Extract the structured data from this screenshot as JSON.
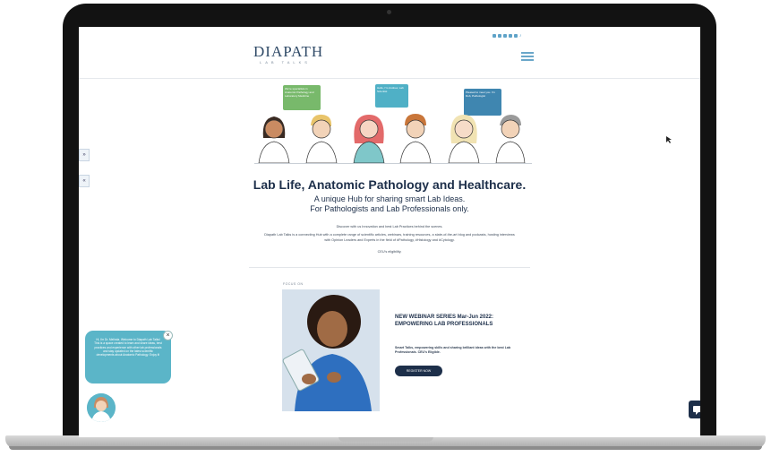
{
  "site": {
    "logo": "DIAPATH",
    "logo_sub": "LAB TALKS"
  },
  "header": {
    "social_icons": [
      "facebook-icon",
      "twitter-icon",
      "linkedin-icon",
      "instagram-icon",
      "youtube-icon",
      "spotify-icon"
    ]
  },
  "side_tabs": [
    "»",
    "«"
  ],
  "illustration": {
    "bubbles": [
      "We're specialists in Anatomic Pathology and Laboratory Medicine",
      "Hello, I'm Andrew, Lab Scientist",
      "Pleased to meet you. I'm Rob, Pathologist"
    ],
    "colors": [
      "#78b96b",
      "#4fb0c6",
      "#3f86b0"
    ]
  },
  "hero": {
    "title": "Lab Life, Anatomic Pathology and Healthcare.",
    "subtitle_1": "A unique Hub for sharing smart Lab Ideas.",
    "subtitle_2": "For Pathologists and Lab Professionals only.",
    "line_1": "Discover with us Innovation and best Lab Practices behind the scenes.",
    "line_2": "Diapath Lab Talks is a connecting Hub with a complete range of scientific articles, webinars, training resources, a state-of-the-art blog and podcasts, hosting interviews",
    "line_3": "with Opinion Leaders and Experts in the field of #Pathology, #Histology and #Cytology.",
    "line_4": "CEU's eligibility."
  },
  "feature": {
    "tag": "FOCUS ON",
    "title": "NEW WEBINAR SERIES Mar-Jun 2022: EMPOWERING LAB PROFESSIONALS",
    "description": "Smart Talks, empowering skills and sharing brilliant ideas with the best Lab Professionals. CEU's Eligible.",
    "button": "REGISTER NOW"
  },
  "chat": {
    "message": "Hi, I'm Dr. Melinda. Welcome to Diapath Lab Talks! This is a space created to learn and share ideas, best practices and experience with other lab professionals and stay updated on the latest scientific developments about Anatomic Pathology. Enjoy it!",
    "close": "×"
  },
  "colors": {
    "navy": "#1d2f4a",
    "teal": "#5bb5c8",
    "green": "#78b96b"
  }
}
